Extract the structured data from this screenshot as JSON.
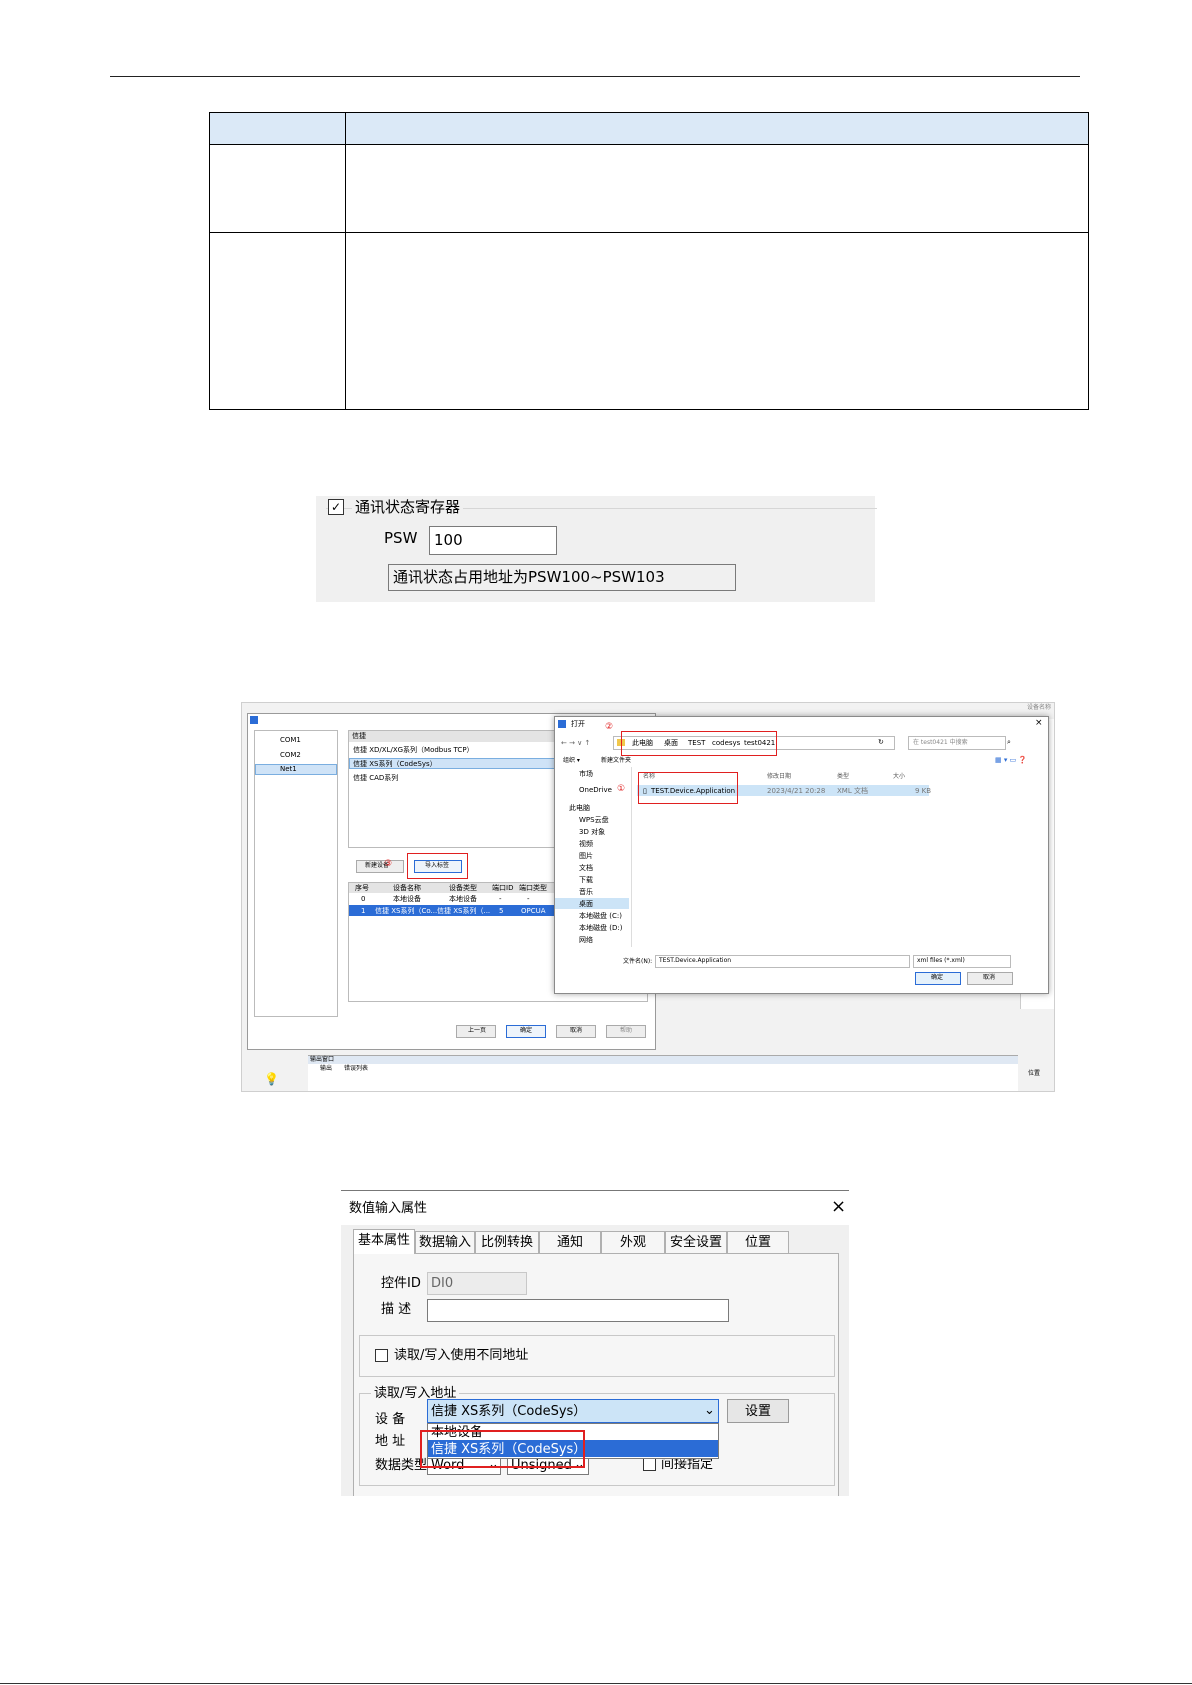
{
  "psw_panel": {
    "checkbox_label": "通讯状态寄存器",
    "psw_label": "PSW",
    "psw_value": "100",
    "info_text": "通讯状态占用地址为PSW100~PSW103"
  },
  "import_screenshot": {
    "corner_label": "设备名称",
    "ports": [
      "COM1",
      "COM2",
      "Net1"
    ],
    "device_list_header": "信捷",
    "device_types": [
      "信捷 XD/XL/XG系列（Modbus TCP）",
      "信捷 XS系列（CodeSys）",
      "信捷 CAD系列"
    ],
    "new_device_btn": "新建设备",
    "import_btn": "导入标签",
    "table_headers": [
      "序号",
      "设备名称",
      "设备类型",
      "端口ID",
      "端口类型"
    ],
    "table_rows": [
      [
        "0",
        "本地设备",
        "本地设备",
        "-",
        "-"
      ],
      [
        "1",
        "信捷 XS系列（Co...",
        "信捷 XS系列（...",
        "5",
        "OPCUA"
      ]
    ],
    "wizard_buttons": [
      "上一页",
      "确定",
      "取消",
      "帮助"
    ],
    "output_window": "输出窗口",
    "output_tabs": [
      "输出",
      "错误列表"
    ],
    "position_label": "位置",
    "open_dialog": {
      "title": "打开",
      "breadcrumb": [
        "此电脑",
        "桌面",
        "TEST",
        "codesys",
        "test0421"
      ],
      "search_placeholder": "在 test0421 中搜索",
      "organize": "组织 ▾",
      "new_folder": "新建文件夹",
      "sidebar": [
        "市场",
        "OneDrive",
        "此电脑",
        "WPS云盘",
        "3D 对象",
        "视频",
        "图片",
        "文档",
        "下载",
        "音乐",
        "桌面",
        "本地磁盘 (C:)",
        "本地磁盘 (D:)",
        "网络"
      ],
      "col_headers": [
        "名称",
        "修改日期",
        "类型",
        "大小"
      ],
      "file": {
        "name": "TEST.Device.Application",
        "date": "2023/4/21 20:28",
        "type": "XML 文档",
        "size": "9 KB"
      },
      "filename_label": "文件名(N):",
      "filename_value": "TEST.Device.Application",
      "filter": "xml files (*.xml)",
      "ok_btn": "确定",
      "cancel_btn": "取消",
      "marker1": "①",
      "marker2": "②",
      "marker3": "③"
    }
  },
  "dialog": {
    "title": "数值输入属性",
    "close_glyph": "×",
    "tabs": [
      "基本属性",
      "数据输入",
      "比例转换",
      "通知",
      "外观",
      "安全设置",
      "位置"
    ],
    "control_id_label": "控件ID",
    "control_id_value": "DI0",
    "desc_label": "描  述",
    "separate_rw_label": "读取/写入使用不同地址",
    "rw_group_label": "读取/写入地址",
    "device_label": "设  备",
    "device_value": "信捷 XS系列（CodeSys）",
    "settings_btn": "设置",
    "address_label": "地  址",
    "datatype_label": "数据类型",
    "datatype_value": "Word",
    "sign_value": "Unsigned",
    "indirect_label": "间接指定",
    "dropdown_options": [
      "本地设备",
      "信捷 XS系列（CodeSys）"
    ]
  }
}
